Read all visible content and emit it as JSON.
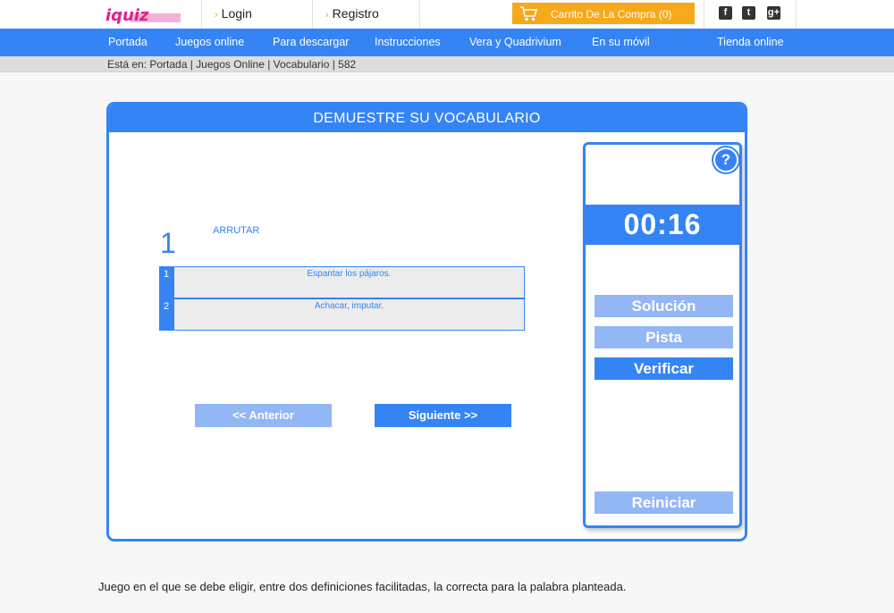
{
  "brand": {
    "logo_text": "iquiz",
    "accent_color": "#3584f5",
    "cart_color": "#f7a81b"
  },
  "topbar": {
    "login_label": "Login",
    "register_label": "Registro",
    "cart_label": "Carrito De La Compra (0)",
    "social": [
      "f",
      "t",
      "g+"
    ]
  },
  "nav": {
    "items": [
      {
        "label": "Portada"
      },
      {
        "label": "Juegos online"
      },
      {
        "label": "Para descargar"
      },
      {
        "label": "Instrucciones"
      },
      {
        "label": "Vera y Quadrivium"
      },
      {
        "label": "En su móvil"
      },
      {
        "label": "Tienda online"
      }
    ]
  },
  "breadcrumb": "Está en: Portada | Juegos Online | Vocabulario | 582",
  "game": {
    "title": "DEMUESTRE SU VOCABULARIO",
    "question_number": "1",
    "word": "ARRUTAR",
    "options": [
      {
        "num": "1",
        "text": "Espantar los pájaros."
      },
      {
        "num": "2",
        "text": "Achacar, imputar."
      }
    ],
    "prev_label": "<< Anterior",
    "next_label": "Siguiente >>"
  },
  "side": {
    "help_label": "?",
    "timer": "00:16",
    "solution_label": "Solución",
    "hint_label": "Pista",
    "verify_label": "Verificar",
    "restart_label": "Reiniciar"
  },
  "description": "Juego en el que se debe eligir, entre dos definiciones facilitadas, la correcta para la palabra planteada."
}
